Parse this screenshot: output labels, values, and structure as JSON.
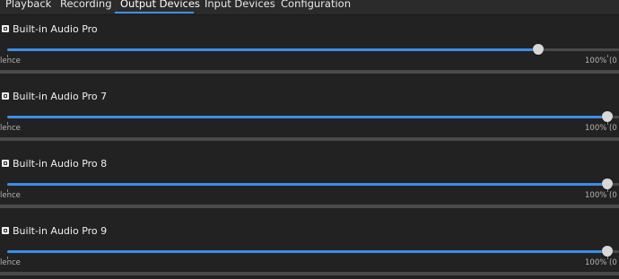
{
  "tabs": [
    {
      "label": "Playback"
    },
    {
      "label": "Recording"
    },
    {
      "label": "Output Devices"
    },
    {
      "label": "Input Devices"
    },
    {
      "label": "Configuration"
    }
  ],
  "active_tab": "Output Devices",
  "devices": [
    {
      "name": "Built-in Audio Pro",
      "volume_fraction": 0.885,
      "left_label": "lence",
      "right_label": "100% (0 d"
    },
    {
      "name": "Built-in Audio Pro 7",
      "volume_fraction": 1.0,
      "left_label": "lence",
      "right_label": "100% (0 d"
    },
    {
      "name": "Built-in Audio Pro 8",
      "volume_fraction": 1.0,
      "left_label": "lence",
      "right_label": "100% (0 d"
    },
    {
      "name": "Built-in Audio Pro 9",
      "volume_fraction": 1.0,
      "left_label": "lence",
      "right_label": "100% (0 d"
    }
  ],
  "colors": {
    "accent": "#3d8ee8",
    "background": "#222222",
    "text": "#f0f0f0"
  }
}
